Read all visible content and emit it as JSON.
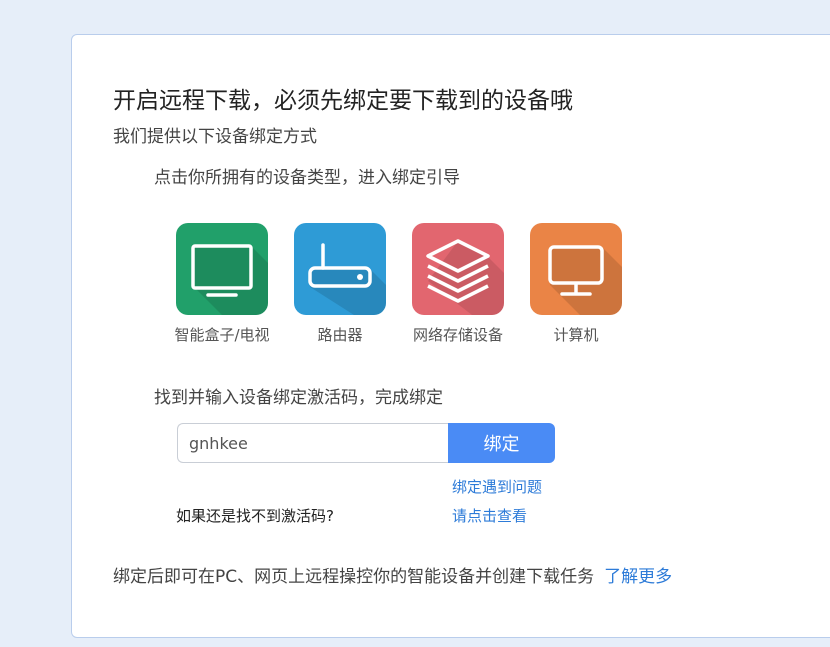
{
  "card": {
    "title": "开启远程下载，必须先绑定要下载到的设备哦",
    "subtitle": "我们提供以下设备绑定方式",
    "step1": "点击你所拥有的设备类型，进入绑定引导",
    "devices": [
      {
        "label": "智能盒子/电视",
        "icon": "tv-icon",
        "color": "#21a06a"
      },
      {
        "label": "路由器",
        "icon": "router-icon",
        "color": "#2e9bd6"
      },
      {
        "label": "网络存储设备",
        "icon": "storage-layers-icon",
        "color": "#e2666f"
      },
      {
        "label": "计算机",
        "icon": "computer-monitor-icon",
        "color": "#ea8446"
      }
    ],
    "step2": "找到并输入设备绑定激活码，完成绑定",
    "code_input": {
      "value": "gnhkee",
      "placeholder": ""
    },
    "bind_button": "绑定",
    "help_link": "绑定遇到问题",
    "not_found_text": "如果还是找不到激活码?",
    "view_link": "请点击查看",
    "footer_text": "绑定后即可在PC、网页上远程操控你的智能设备并创建下载任务",
    "learn_more": "了解更多"
  }
}
